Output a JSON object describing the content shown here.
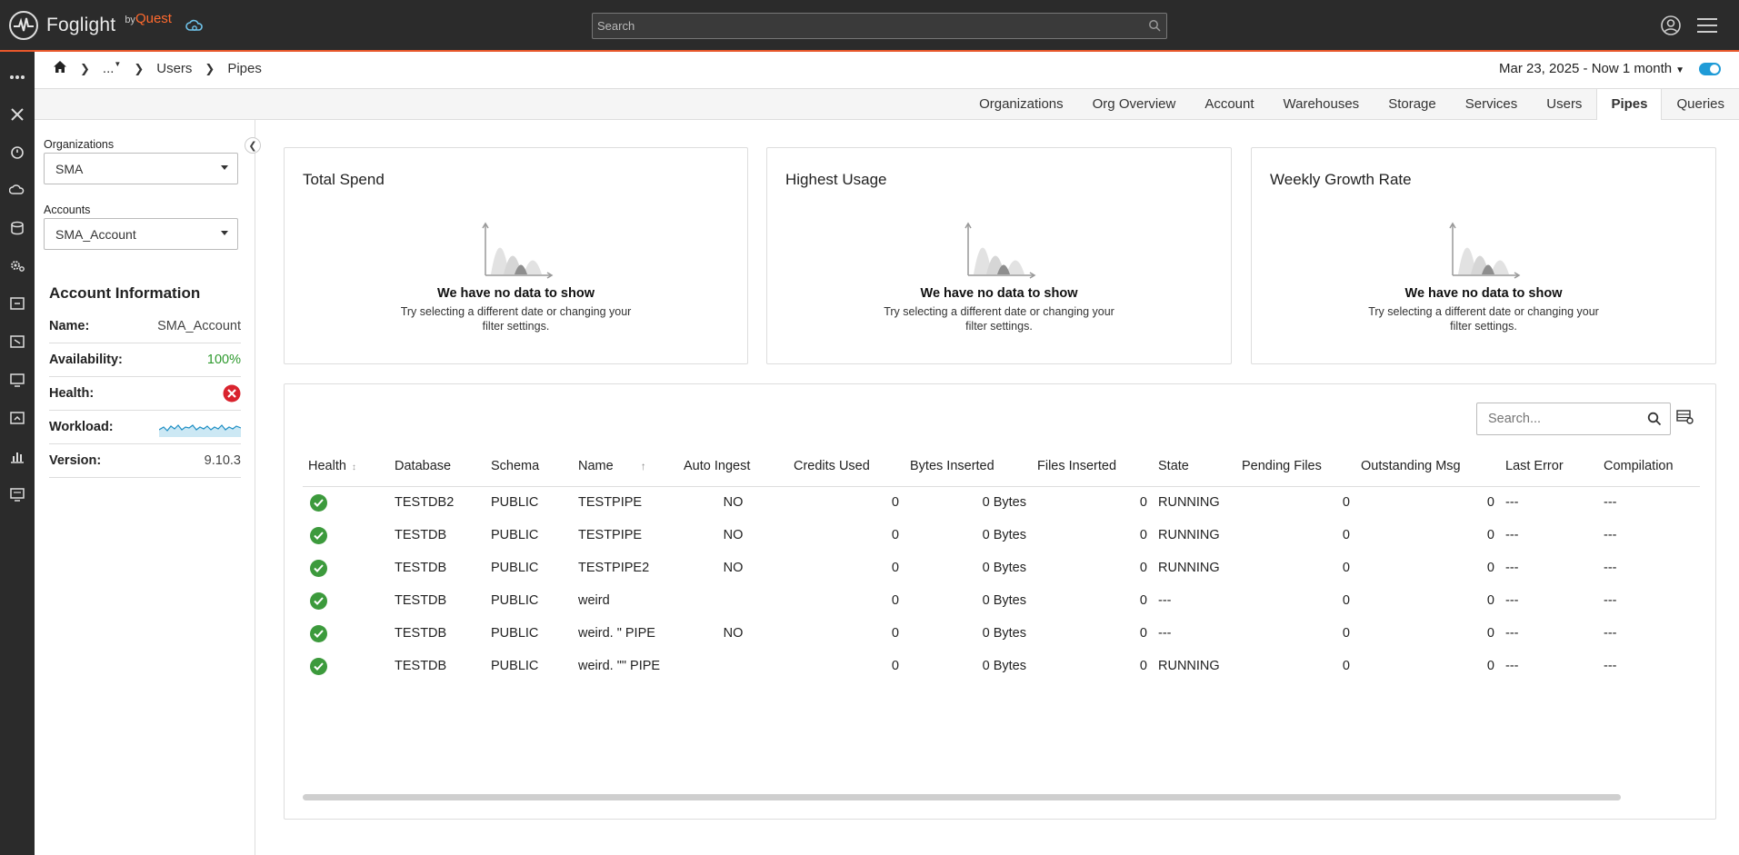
{
  "app": {
    "name": "Foglight",
    "by_label": "by",
    "by_brand": "Quest",
    "search_placeholder": "Search"
  },
  "breadcrumb": {
    "ellipsis": "...",
    "items": [
      "Users",
      "Pipes"
    ]
  },
  "date_range": "Mar 23, 2025 - Now 1 month",
  "tabs": [
    {
      "label": "Organizations"
    },
    {
      "label": "Org Overview"
    },
    {
      "label": "Account"
    },
    {
      "label": "Warehouses"
    },
    {
      "label": "Storage"
    },
    {
      "label": "Services"
    },
    {
      "label": "Users"
    },
    {
      "label": "Pipes",
      "active": true
    },
    {
      "label": "Queries"
    }
  ],
  "filters": {
    "organizations_label": "Organizations",
    "organizations_value": "SMA",
    "accounts_label": "Accounts",
    "accounts_value": "SMA_Account"
  },
  "account_info": {
    "title": "Account Information",
    "name_label": "Name:",
    "name_value": "SMA_Account",
    "availability_label": "Availability:",
    "availability_value": "100%",
    "health_label": "Health:",
    "workload_label": "Workload:",
    "version_label": "Version:",
    "version_value": "9.10.3"
  },
  "cards": [
    {
      "title": "Total Spend",
      "nodata_title": "We have no data to show",
      "nodata_text": "Try selecting a different date or changing your filter settings."
    },
    {
      "title": "Highest Usage",
      "nodata_title": "We have no data to show",
      "nodata_text": "Try selecting a different date or changing your filter settings."
    },
    {
      "title": "Weekly Growth Rate",
      "nodata_title": "We have no data to show",
      "nodata_text": "Try selecting a different date or changing your filter settings."
    }
  ],
  "table": {
    "search_placeholder": "Search...",
    "columns": [
      "Health",
      "Database",
      "Schema",
      "Name",
      "Auto Ingest",
      "Credits Used",
      "Bytes Inserted",
      "Files Inserted",
      "State",
      "Pending Files",
      "Outstanding Msg",
      "Last Error",
      "Compilation"
    ],
    "rows": [
      {
        "database": "TESTDB2",
        "schema": "PUBLIC",
        "name": "TESTPIPE",
        "auto_ingest": "NO",
        "credits": "0",
        "bytes": "0 Bytes",
        "files": "0",
        "state": "RUNNING",
        "pending": "0",
        "outstanding": "0",
        "last_error": "---",
        "compilation": "---"
      },
      {
        "database": "TESTDB",
        "schema": "PUBLIC",
        "name": "TESTPIPE",
        "auto_ingest": "NO",
        "credits": "0",
        "bytes": "0 Bytes",
        "files": "0",
        "state": "RUNNING",
        "pending": "0",
        "outstanding": "0",
        "last_error": "---",
        "compilation": "---"
      },
      {
        "database": "TESTDB",
        "schema": "PUBLIC",
        "name": "TESTPIPE2",
        "auto_ingest": "NO",
        "credits": "0",
        "bytes": "0 Bytes",
        "files": "0",
        "state": "RUNNING",
        "pending": "0",
        "outstanding": "0",
        "last_error": "---",
        "compilation": "---"
      },
      {
        "database": "TESTDB",
        "schema": "PUBLIC",
        "name": "weird",
        "auto_ingest": "",
        "credits": "0",
        "bytes": "0 Bytes",
        "files": "0",
        "state": "---",
        "pending": "0",
        "outstanding": "0",
        "last_error": "---",
        "compilation": "---"
      },
      {
        "database": "TESTDB",
        "schema": "PUBLIC",
        "name": "weird. \" PIPE",
        "auto_ingest": "NO",
        "credits": "0",
        "bytes": "0 Bytes",
        "files": "0",
        "state": "---",
        "pending": "0",
        "outstanding": "0",
        "last_error": "---",
        "compilation": "---"
      },
      {
        "database": "TESTDB",
        "schema": "PUBLIC",
        "name": "weird. \"\" PIPE",
        "auto_ingest": "",
        "credits": "0",
        "bytes": "0 Bytes",
        "files": "0",
        "state": "RUNNING",
        "pending": "0",
        "outstanding": "0",
        "last_error": "---",
        "compilation": "---"
      }
    ]
  },
  "colors": {
    "accent_orange": "#e8582b",
    "toggle_blue": "#1f9bd7",
    "ok_green": "#3c9a3c",
    "error_red": "#d9232e"
  }
}
